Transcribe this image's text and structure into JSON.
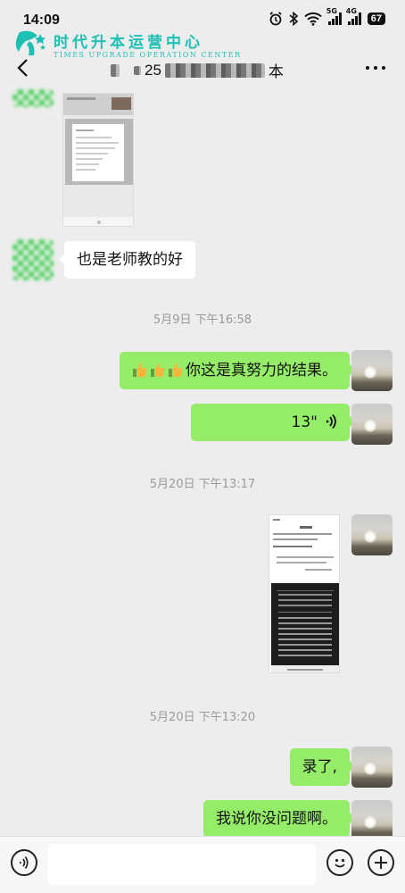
{
  "status_bar": {
    "time": "14:09",
    "battery": "67",
    "net1": "5G",
    "net2": "4G"
  },
  "watermark": {
    "cn": "时代升本运营中心",
    "en": "TIMES UPGRADE OPERATION CENTER"
  },
  "header": {
    "title_number": "25",
    "title_suffix": "本"
  },
  "messages": {
    "m1_text": "也是老师教的好",
    "ts1": "5月9日 下午16:58",
    "m2_text": "你这是真努力的结果。",
    "m3_duration": "13\"",
    "ts2": "5月20日 下午13:17",
    "ts3": "5月20日 下午13:20",
    "m5_text": "录了,",
    "m6_text": "我说你没问题啊。"
  },
  "icons": [
    "back-icon",
    "more-icon",
    "alarm-icon",
    "bluetooth-icon",
    "wifi-icon",
    "signal-icon",
    "voice-wave-icon",
    "thumbs-up-icon",
    "voice-input-icon",
    "emoji-icon",
    "add-icon"
  ],
  "colors": {
    "sent_bubble": "#95ec69",
    "received_bubble": "#ffffff",
    "background": "#ededed",
    "watermark": "#1ec0b4"
  }
}
